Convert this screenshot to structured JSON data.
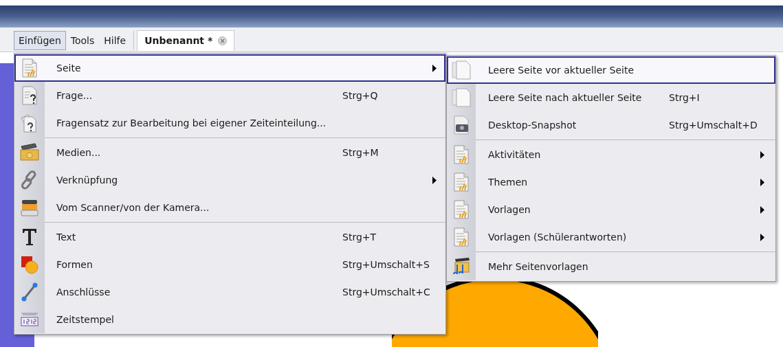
{
  "menu_bar": {
    "items": [
      {
        "label": "Einfügen",
        "selected": true
      },
      {
        "label": "Tools",
        "selected": false
      },
      {
        "label": "Hilfe",
        "selected": false
      }
    ]
  },
  "document_tab": {
    "title": "Unbenannt *",
    "close": "×"
  },
  "menu": {
    "sections": [
      [
        {
          "label": "Seite",
          "submenu": true,
          "selected": true
        },
        {
          "label": "Frage...",
          "shortcut": "Strg+Q",
          "submenu": false,
          "selected": false
        },
        {
          "label": "Fragensatz zur Bearbeitung bei eigener Zeiteinteilung...",
          "submenu": false,
          "selected": false
        }
      ],
      [
        {
          "label": "Medien...",
          "shortcut": "Strg+M",
          "submenu": false,
          "selected": false
        },
        {
          "label": "Verknüpfung",
          "submenu": true,
          "selected": false
        },
        {
          "label": "Vom Scanner/von der Kamera...",
          "submenu": false,
          "selected": false
        }
      ],
      [
        {
          "label": "Text",
          "shortcut": "Strg+T",
          "submenu": false,
          "selected": false
        },
        {
          "label": "Formen",
          "shortcut": "Strg+Umschalt+S",
          "submenu": false,
          "selected": false
        },
        {
          "label": "Anschlüsse",
          "shortcut": "Strg+Umschalt+C",
          "submenu": false,
          "selected": false
        },
        {
          "label": "Zeitstempel",
          "submenu": false,
          "selected": false
        }
      ]
    ]
  },
  "submenu": {
    "sections": [
      [
        {
          "label": "Leere Seite vor aktueller Seite",
          "submenu": false,
          "selected": true
        },
        {
          "label": "Leere Seite nach aktueller Seite",
          "shortcut": "Strg+I",
          "submenu": false,
          "selected": false
        },
        {
          "label": "Desktop-Snapshot",
          "shortcut": "Strg+Umschalt+D",
          "submenu": false,
          "selected": false
        }
      ],
      [
        {
          "label": "Aktivitäten",
          "submenu": true,
          "selected": false
        },
        {
          "label": "Themen",
          "submenu": true,
          "selected": false
        },
        {
          "label": "Vorlagen",
          "submenu": true,
          "selected": false
        },
        {
          "label": "Vorlagen (Schülerantworten)",
          "submenu": true,
          "selected": false
        }
      ],
      [
        {
          "label": "Mehr Seitenvorlagen",
          "submenu": false,
          "selected": false
        }
      ]
    ]
  }
}
